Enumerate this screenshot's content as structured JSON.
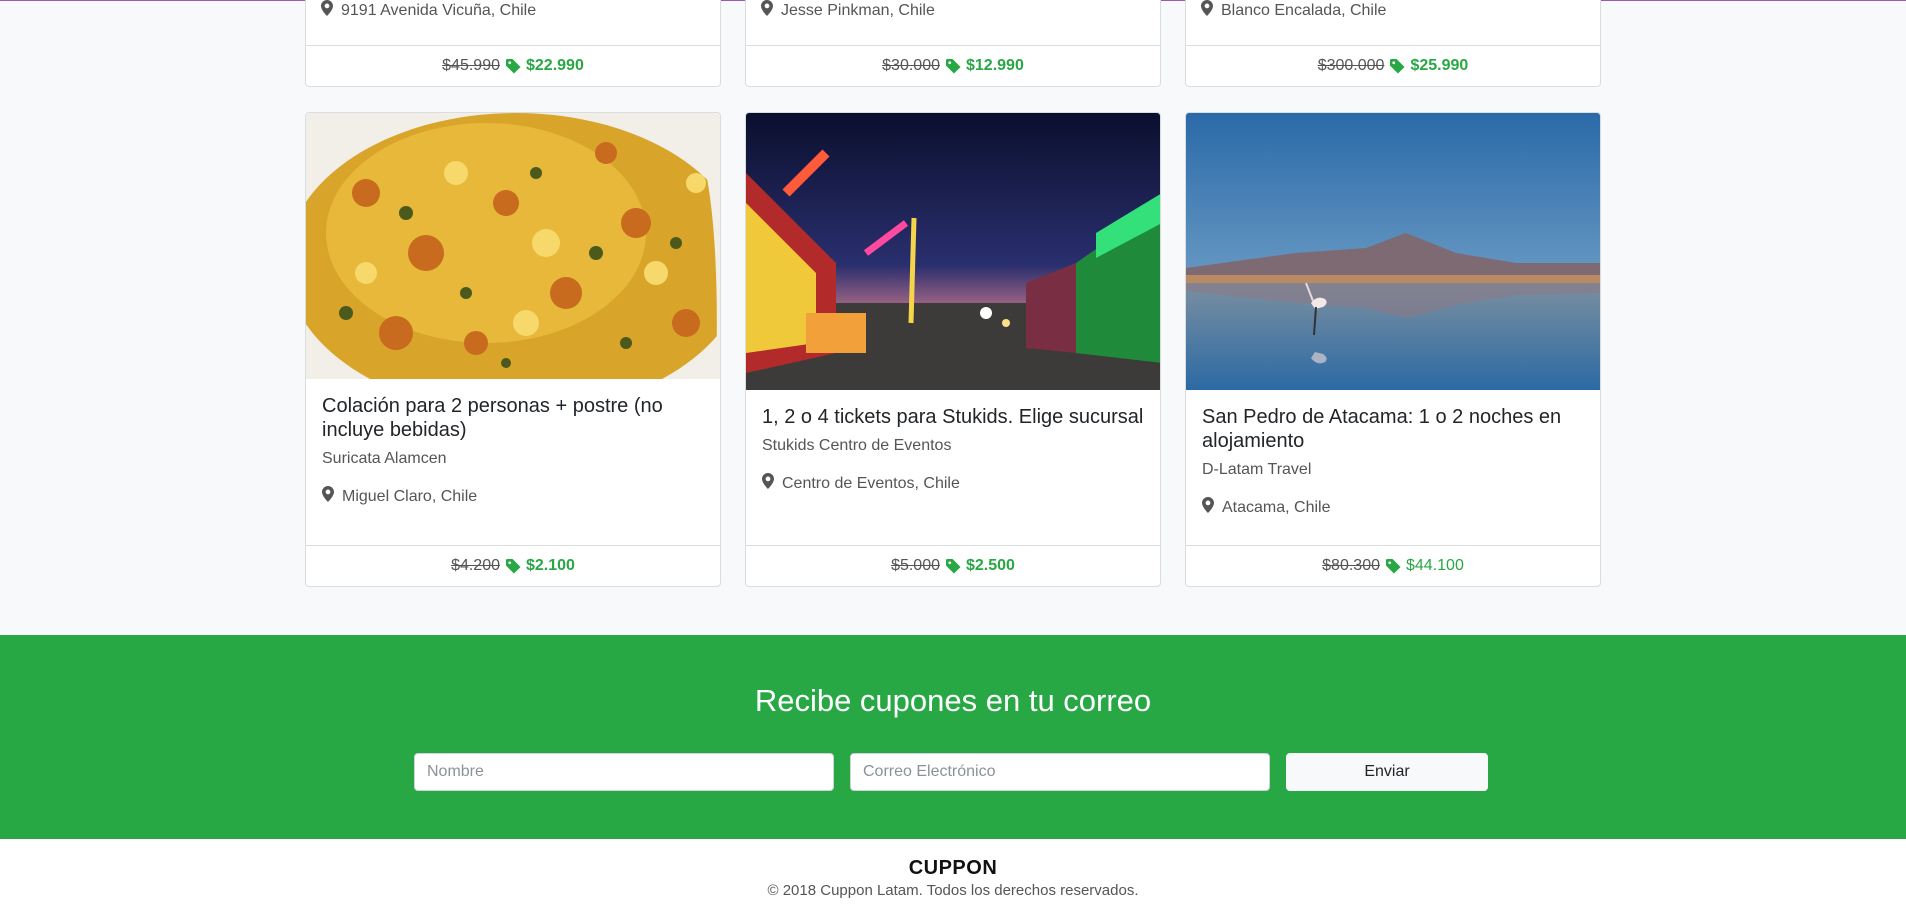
{
  "top_cards": [
    {
      "location": "9191 Avenida Vicuña, Chile",
      "old_price": "$45.990",
      "new_price": "$22.990"
    },
    {
      "location": "Jesse Pinkman, Chile",
      "old_price": "$30.000",
      "new_price": "$12.990"
    },
    {
      "location": "Blanco Encalada, Chile",
      "old_price": "$300.000",
      "new_price": "$25.990"
    }
  ],
  "cards": [
    {
      "title": "Colación para 2 personas + postre (no incluye bebidas)",
      "merchant": "Suricata Alamcen",
      "location": "Miguel Claro, Chile",
      "old_price": "$4.200",
      "new_price": "$2.100",
      "image": "food-photo"
    },
    {
      "title": "1, 2 o 4 tickets para Stukids. Elige sucursal",
      "merchant": "Stukids Centro de Eventos",
      "location": "Centro de Eventos, Chile",
      "old_price": "$5.000",
      "new_price": "$2.500",
      "image": "fair-photo"
    },
    {
      "title": "San Pedro de Atacama: 1 o 2 noches en alojamiento",
      "merchant": "D-Latam Travel",
      "location": "Atacama, Chile",
      "old_price": "$80.300",
      "new_price": "$44.100",
      "image": "atacama-photo"
    }
  ],
  "newsletter": {
    "title": "Recibe cupones en tu correo",
    "name_placeholder": "Nombre",
    "email_placeholder": "Correo Electrónico",
    "submit_label": "Enviar",
    "background_color": "#28a745"
  },
  "footer": {
    "brand": "CUPPON",
    "copyright": "© 2018 Cuppon Latam. Todos los derechos reservados."
  },
  "colors": {
    "accent": "#28a745",
    "marker": "#555555"
  },
  "icons": {
    "location": "map-marker-icon",
    "price": "tag-icon"
  }
}
